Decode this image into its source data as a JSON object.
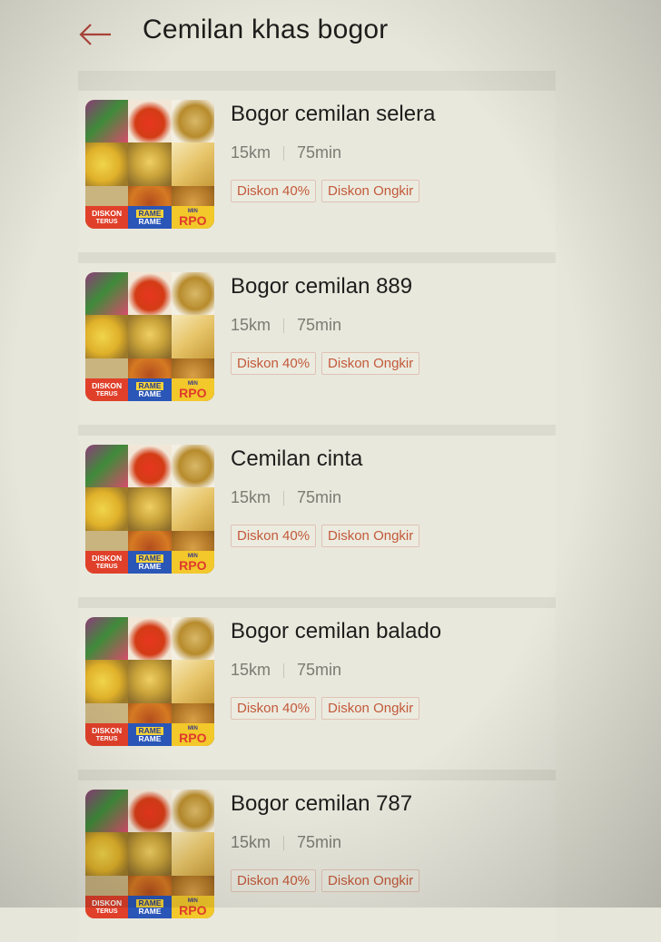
{
  "header": {
    "title": "Cemilan khas bogor"
  },
  "shops": [
    {
      "name": "Bogor cemilan selera",
      "distance": "15km",
      "time": "75min",
      "tags": [
        "Diskon 40%",
        "Diskon Ongkir"
      ]
    },
    {
      "name": "Bogor cemilan 889",
      "distance": "15km",
      "time": "75min",
      "tags": [
        "Diskon 40%",
        "Diskon Ongkir"
      ]
    },
    {
      "name": "Cemilan cinta",
      "distance": "15km",
      "time": "75min",
      "tags": [
        "Diskon 40%",
        "Diskon Ongkir"
      ]
    },
    {
      "name": "Bogor cemilan balado",
      "distance": "15km",
      "time": "75min",
      "tags": [
        "Diskon 40%",
        "Diskon Ongkir"
      ]
    },
    {
      "name": "Bogor cemilan 787",
      "distance": "15km",
      "time": "75min",
      "tags": [
        "Diskon 40%",
        "Diskon Ongkir"
      ]
    }
  ],
  "thumbnail": {
    "badge_left": [
      "DISKON",
      "TERUS"
    ],
    "badge_mid": [
      "RAME",
      "RAME"
    ],
    "badge_right": [
      "MIN",
      "RPO"
    ]
  },
  "colors": {
    "accent": "#c25a3a",
    "back_arrow": "#b1453a",
    "text": "#1d1d1b",
    "muted": "#7c7b74"
  },
  "icons": {
    "back": "arrow-left-icon"
  }
}
